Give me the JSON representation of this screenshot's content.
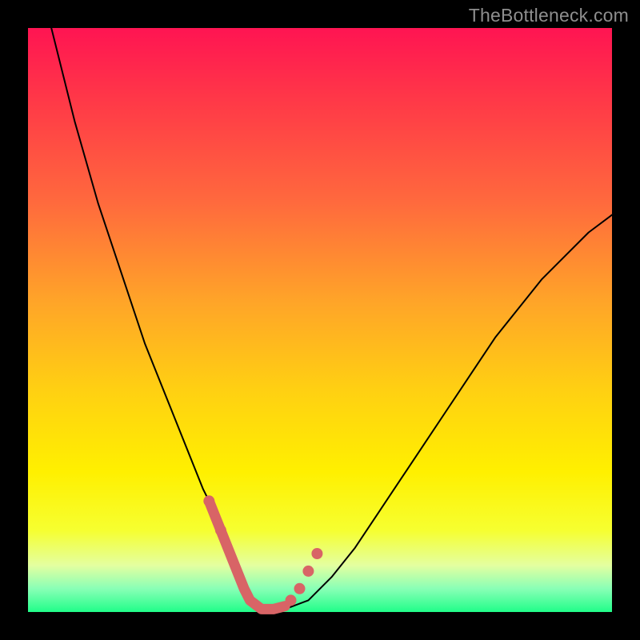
{
  "watermark": "TheBottleneck.com",
  "chart_data": {
    "type": "line",
    "title": "",
    "xlabel": "",
    "ylabel": "",
    "xlim": [
      0,
      100
    ],
    "ylim": [
      0,
      100
    ],
    "grid": false,
    "legend": false,
    "series": [
      {
        "name": "bottleneck-curve",
        "x": [
          4,
          6,
          8,
          10,
          12,
          14,
          16,
          18,
          20,
          22,
          24,
          26,
          28,
          30,
          32,
          34,
          36,
          37,
          38,
          40,
          44,
          48,
          52,
          56,
          60,
          64,
          68,
          72,
          76,
          80,
          84,
          88,
          92,
          96,
          100
        ],
        "y": [
          100,
          92,
          84,
          77,
          70,
          64,
          58,
          52,
          46,
          41,
          36,
          31,
          26,
          21,
          17,
          12,
          7,
          4,
          2,
          0.5,
          0.5,
          2,
          6,
          11,
          17,
          23,
          29,
          35,
          41,
          47,
          52,
          57,
          61,
          65,
          68
        ]
      }
    ],
    "highlight": {
      "name": "optimal-range",
      "segment_x": [
        31,
        33,
        35,
        37,
        38,
        40,
        42,
        44
      ],
      "segment_y": [
        19,
        14,
        9,
        4,
        2,
        0.5,
        0.5,
        1
      ],
      "dots": [
        {
          "x": 31,
          "y": 19
        },
        {
          "x": 33,
          "y": 14
        },
        {
          "x": 45,
          "y": 2
        },
        {
          "x": 46.5,
          "y": 4
        },
        {
          "x": 48,
          "y": 7
        },
        {
          "x": 49.5,
          "y": 10
        }
      ]
    },
    "background_gradient": {
      "top": "#ff1452",
      "bottom": "#20fd89",
      "stops": [
        "#ff1452",
        "#ff3a47",
        "#ff6a3d",
        "#ffa528",
        "#ffd012",
        "#fff000",
        "#f6ff30",
        "#e4ffa0",
        "#89ffb6",
        "#20fd89"
      ]
    }
  }
}
